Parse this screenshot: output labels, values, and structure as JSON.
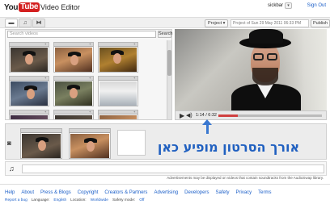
{
  "header": {
    "logo_you": "You",
    "logo_tube": "Tube",
    "app_title": "Video Editor",
    "username": "sickbar",
    "user_menu_glyph": "▾",
    "sign_out": "Sign Out"
  },
  "toolbar": {
    "tabs": [
      {
        "name": "video-tab",
        "icon": "video-camera-icon",
        "glyph": "▬"
      },
      {
        "name": "audio-tab",
        "icon": "music-note-icon",
        "glyph": "♫"
      },
      {
        "name": "transitions-tab",
        "icon": "transition-icon",
        "glyph": "⧓"
      }
    ],
    "project_label": "Project ▾",
    "project_name": "Project of Sun 29 May 2011 06:33 PM",
    "publish_label": "Publish"
  },
  "media": {
    "search_placeholder": "Search videos",
    "search_button": "Search",
    "thumb_plus": "+"
  },
  "player": {
    "play_glyph": "▶",
    "volume_glyph": "◀)",
    "time": "1:14 / 6:32",
    "progress": 0.19
  },
  "annotation": {
    "text": "אורך הסרטון מופיע כאן",
    "color": "#2060c0"
  },
  "timeline": {
    "camera_glyph": "◙",
    "note_glyph": "♫"
  },
  "disclaimer": "Advertisements may be displayed on videos that contain soundtracks from the AudioSwap library.",
  "footer": {
    "links": [
      "Help",
      "About",
      "Press & Blogs",
      "Copyright",
      "Creators & Partners",
      "Advertising",
      "Developers",
      "Safety",
      "Privacy",
      "Terms"
    ],
    "report_bug": "Report a bug",
    "language_label": "Language:",
    "language_value": "English",
    "location_label": "Location:",
    "location_value": "Worldwide",
    "safety_label": "Safety mode:",
    "safety_value": "Off"
  },
  "colors": {
    "brand_red": "#d42020",
    "link_blue": "#1a5ec8",
    "accent_blue": "#3a78d0"
  }
}
